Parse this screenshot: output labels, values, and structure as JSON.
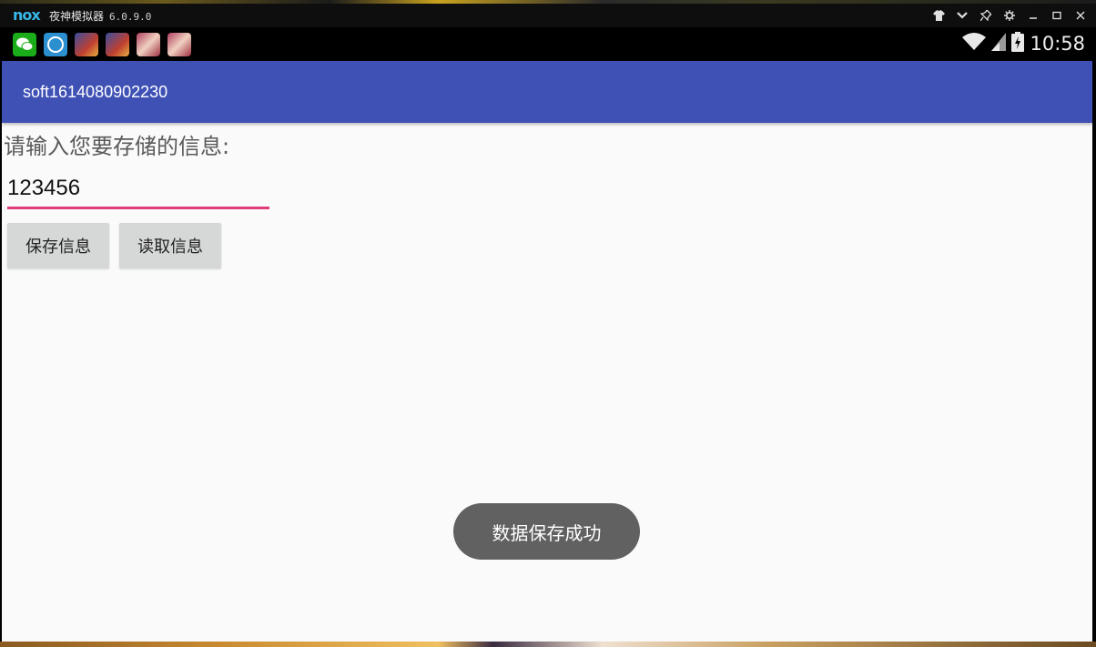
{
  "emulator": {
    "logo": "nox",
    "title": "夜神模拟器",
    "version": "6.0.9.0",
    "controls": [
      {
        "name": "tshirt-icon",
        "glyph": "👕"
      },
      {
        "name": "chevron-down-icon",
        "glyph": "⌄"
      },
      {
        "name": "pin-icon",
        "glyph": "✎"
      },
      {
        "name": "gear-icon",
        "glyph": "⚙"
      },
      {
        "name": "minimize-icon",
        "glyph": "–"
      },
      {
        "name": "maximize-icon",
        "glyph": "☐"
      },
      {
        "name": "close-icon",
        "glyph": "✕"
      }
    ]
  },
  "statusbar": {
    "notification_icons": [
      "wechat-icon",
      "nox-icon",
      "game-icon",
      "game-icon",
      "game-icon",
      "game-icon"
    ],
    "time": "10:58"
  },
  "app": {
    "title": "soft1614080902230",
    "prompt": "请输入您要存储的信息:",
    "input_value": "123456",
    "save_button": "保存信息",
    "read_button": "读取信息",
    "toast": "数据保存成功"
  },
  "colors": {
    "appbar": "#3f51b5",
    "input_underline": "#e23c7b",
    "toast_bg": "#616161"
  }
}
